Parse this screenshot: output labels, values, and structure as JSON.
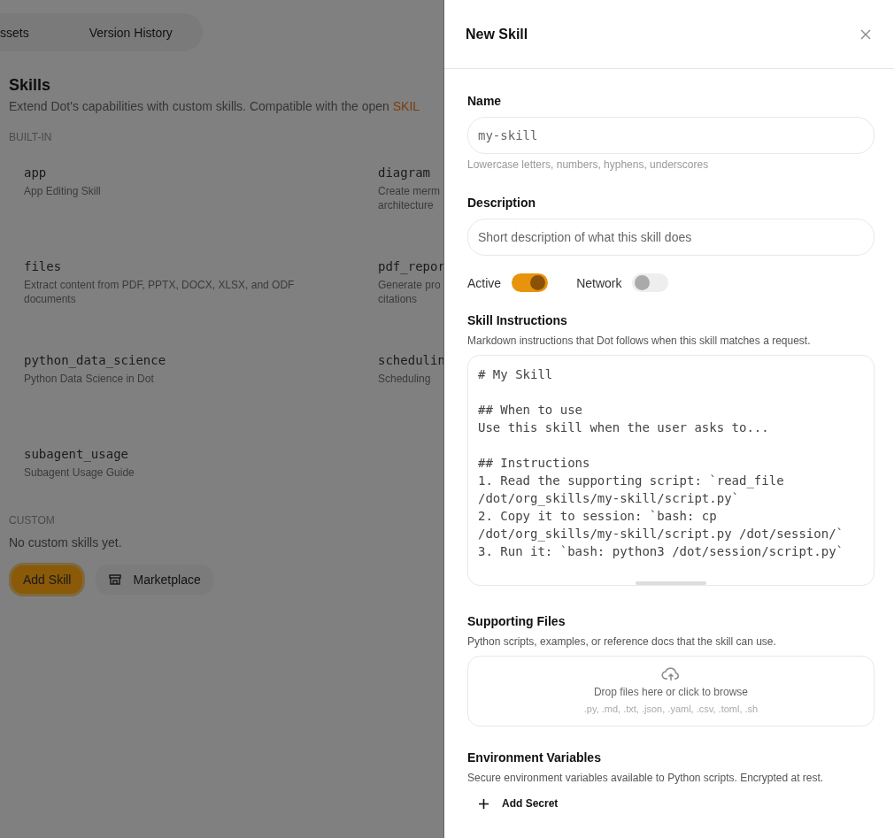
{
  "background_page": {
    "tabs": [
      {
        "label": "ssets"
      },
      {
        "label": "Version History"
      }
    ],
    "title": "Skills",
    "subtitle": "Extend Dot's capabilities with custom skills. Compatible with the open ",
    "subtitle_link": "SKIL",
    "built_in": {
      "heading": "BUILT-IN",
      "skills": [
        {
          "name": "app",
          "description": "App Editing Skill"
        },
        {
          "name": "diagram",
          "description": "Create merm\narchitecture"
        },
        {
          "name": "files",
          "description": "Extract content from PDF, PPTX, DOCX, XLSX, and ODF\ndocuments"
        },
        {
          "name": "pdf_repor",
          "description": "Generate pro\ncitations"
        },
        {
          "name": "python_data_science",
          "description": "Python Data Science in Dot"
        },
        {
          "name": "schedulin",
          "description": "Scheduling"
        },
        {
          "name": "subagent_usage",
          "description": "Subagent Usage Guide"
        }
      ]
    },
    "custom": {
      "heading": "CUSTOM",
      "empty_text": "No custom skills yet."
    },
    "buttons": [
      {
        "label": "Add Skill",
        "kind": "primary"
      },
      {
        "label": "Marketplace",
        "kind": "secondary"
      }
    ]
  },
  "drawer": {
    "title": "New Skill",
    "fields": [
      {
        "label": "Name",
        "placeholder": "my-skill",
        "kind": "code",
        "hint": "Lowercase letters, numbers, hyphens, underscores"
      },
      {
        "label": "Description",
        "placeholder": "Short description of what this skill does",
        "kind": "text"
      }
    ],
    "toggles": [
      {
        "label": "Active",
        "on": true
      },
      {
        "label": "Network",
        "on": false
      }
    ],
    "instructions": {
      "label": "Skill Instructions",
      "hint": "Markdown instructions that Dot follows when this skill matches a request.",
      "value": "# My Skill\n\n## When to use\nUse this skill when the user asks to...\n\n## Instructions\n1. Read the supporting script: `read_file\n/dot/org_skills/my-skill/script.py`\n2. Copy it to session: `bash: cp\n/dot/org_skills/my-skill/script.py /dot/session/`\n3. Run it: `bash: python3 /dot/session/script.py`"
    },
    "supporting_files": {
      "label": "Supporting Files",
      "hint": "Python scripts, examples, or reference docs that the skill can use.",
      "drop_text": "Drop files here or click to browse",
      "formats": ".py, .md, .txt, .json, .yaml, .csv, .toml, .sh"
    },
    "environment": {
      "label": "Environment Variables",
      "hint": "Secure environment variables available to Python scripts. Encrypted at rest.",
      "add_button": "Add Secret"
    }
  }
}
